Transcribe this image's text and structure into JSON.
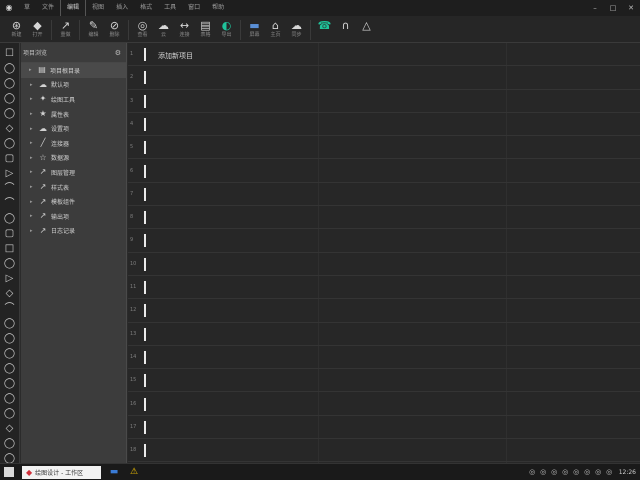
{
  "menubar": {
    "items": [
      "草",
      "文件",
      "编辑",
      "视图",
      "插入",
      "格式",
      "工具",
      "窗口",
      "帮助"
    ],
    "active_index": 2,
    "window_controls": [
      "–",
      "□",
      "✕"
    ]
  },
  "ribbon": {
    "tools": [
      {
        "icon": "⊛",
        "caption": "新建",
        "icon_name": "new-icon"
      },
      {
        "icon": "◆",
        "caption": "打开",
        "icon_name": "open-icon"
      },
      {
        "icon": "sep"
      },
      {
        "icon": "↗",
        "caption": "重做",
        "icon_name": "redo-icon"
      },
      {
        "icon": "sep"
      },
      {
        "icon": "✎",
        "caption": "编辑",
        "icon_name": "pen-icon"
      },
      {
        "icon": "⊘",
        "caption": "删除",
        "icon_name": "delete-icon"
      },
      {
        "icon": "sep"
      },
      {
        "icon": "◎",
        "caption": "查看",
        "icon_name": "view-icon"
      },
      {
        "icon": "☁",
        "caption": "云",
        "icon_name": "cloud-icon"
      },
      {
        "icon": "↔",
        "caption": "连接",
        "icon_name": "connect-icon"
      },
      {
        "icon": "▤",
        "caption": "表格",
        "icon_name": "table-icon"
      },
      {
        "icon": "◐",
        "caption": "导出",
        "icon_name": "export-icon",
        "color": "green"
      },
      {
        "icon": "sep"
      },
      {
        "icon": "▬",
        "caption": "屏幕",
        "icon_name": "screen-icon",
        "color": "blue"
      },
      {
        "icon": "⌂",
        "caption": "主页",
        "icon_name": "home-icon"
      },
      {
        "icon": "☁",
        "caption": "同步",
        "icon_name": "sync-icon"
      },
      {
        "icon": "sep"
      },
      {
        "icon": "☎",
        "caption": "",
        "icon_name": "phone-icon",
        "color": "green"
      },
      {
        "icon": "∩",
        "caption": "",
        "icon_name": "magnet-icon"
      },
      {
        "icon": "△",
        "caption": "",
        "icon_name": "flask-icon"
      }
    ]
  },
  "rail": {
    "icons": [
      "☐",
      "◯",
      "◯",
      "◯",
      "◯",
      "◇",
      "◯",
      "▢",
      "▷",
      "⌒",
      "⌒",
      "◯",
      "▢",
      "□",
      "◯",
      "▷",
      "◇",
      "⌒",
      "◯",
      "◯",
      "◯",
      "◯",
      "◯",
      "◯",
      "◯",
      "◇",
      "◯",
      "◯"
    ]
  },
  "tree": {
    "header": "项目浏览",
    "pin_icon": "⚙",
    "items": [
      {
        "label": "项目根目录",
        "icon": "▤",
        "root": true
      },
      {
        "label": "默认项",
        "icon": "☁"
      },
      {
        "label": "绘图工具",
        "icon": "✦"
      },
      {
        "label": "属性表",
        "icon": "★"
      },
      {
        "label": "设置项",
        "icon": "☁"
      },
      {
        "label": "连接器",
        "icon": "╱"
      },
      {
        "label": "数据源",
        "icon": "☆"
      },
      {
        "label": "图层管理",
        "icon": "↗"
      },
      {
        "label": "样式表",
        "icon": "↗"
      },
      {
        "label": "模板组件",
        "icon": "↗"
      },
      {
        "label": "输出项",
        "icon": "↗"
      },
      {
        "label": "日志记录",
        "icon": "↗"
      }
    ]
  },
  "grid": {
    "rows": [
      {
        "num": "1",
        "text": "添加新项目"
      },
      {
        "num": "2",
        "text": ""
      },
      {
        "num": "3",
        "text": ""
      },
      {
        "num": "4",
        "text": ""
      },
      {
        "num": "5",
        "text": ""
      },
      {
        "num": "6",
        "text": ""
      },
      {
        "num": "7",
        "text": ""
      },
      {
        "num": "8",
        "text": ""
      },
      {
        "num": "9",
        "text": ""
      },
      {
        "num": "10",
        "text": ""
      },
      {
        "num": "11",
        "text": ""
      },
      {
        "num": "12",
        "text": ""
      },
      {
        "num": "13",
        "text": ""
      },
      {
        "num": "14",
        "text": ""
      },
      {
        "num": "15",
        "text": ""
      },
      {
        "num": "16",
        "text": ""
      },
      {
        "num": "17",
        "text": ""
      },
      {
        "num": "18",
        "text": ""
      }
    ]
  },
  "taskbar": {
    "app_label": "绘图设计 - 工作区",
    "app_icon": "◆",
    "icons": [
      {
        "icon": "▬",
        "icon_name": "screen-icon",
        "color": "blue"
      },
      {
        "icon": "⚠",
        "icon_name": "warning-icon",
        "color": "warn"
      }
    ],
    "tray": [
      "◎",
      "◎",
      "◎",
      "◎",
      "◎",
      "◎",
      "◎",
      "◎"
    ],
    "clock": "12:26"
  }
}
